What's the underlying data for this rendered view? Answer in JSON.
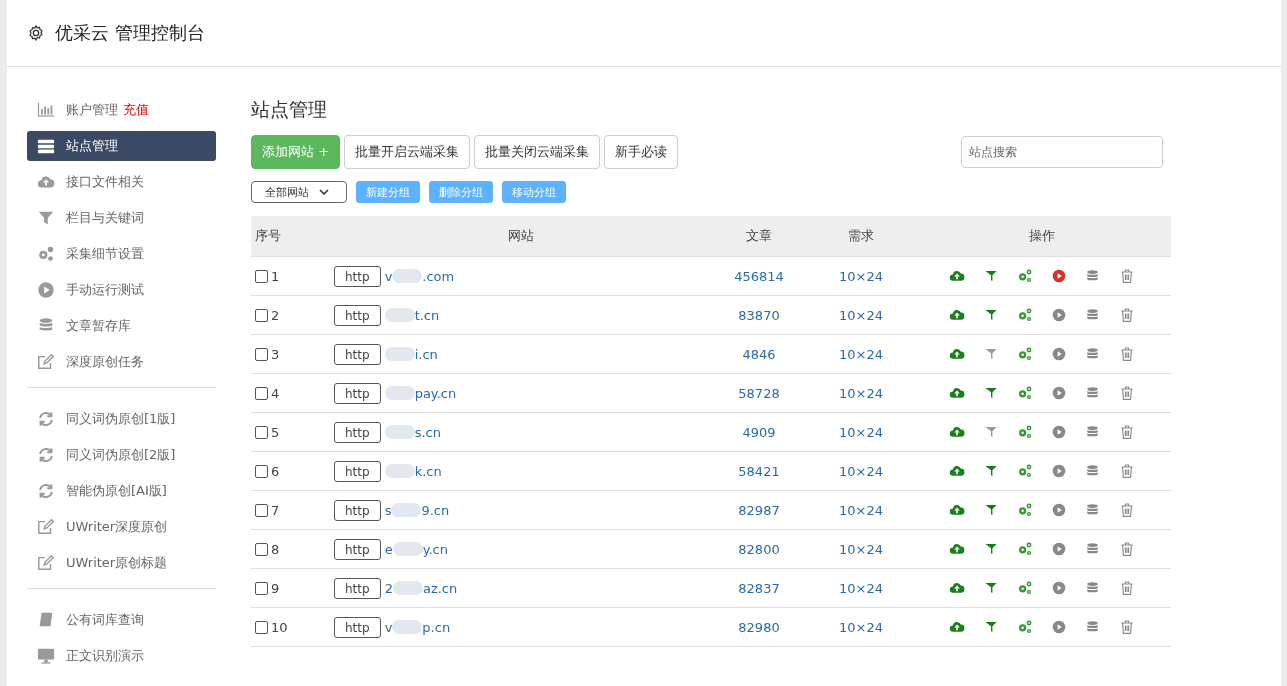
{
  "header": {
    "title": "优采云 管理控制台"
  },
  "sidebar": {
    "groups": [
      [
        {
          "label": "账户管理",
          "badge": "充值",
          "kind": "chart",
          "selected": false
        },
        {
          "label": "站点管理",
          "kind": "server",
          "selected": true
        },
        {
          "label": "接口文件相关",
          "kind": "cloud",
          "selected": false
        },
        {
          "label": "栏目与关键词",
          "kind": "filter",
          "selected": false
        },
        {
          "label": "采集细节设置",
          "kind": "gears",
          "selected": false
        },
        {
          "label": "手动运行测试",
          "kind": "play",
          "selected": false
        },
        {
          "label": "文章暂存库",
          "kind": "database",
          "selected": false
        },
        {
          "label": "深度原创任务",
          "kind": "edit",
          "selected": false
        }
      ],
      [
        {
          "label": "同义词伪原创[1版]",
          "kind": "refresh",
          "selected": false
        },
        {
          "label": "同义词伪原创[2版]",
          "kind": "refresh",
          "selected": false
        },
        {
          "label": "智能伪原创[AI版]",
          "kind": "refresh",
          "selected": false
        },
        {
          "label": "UWriter深度原创",
          "kind": "edit",
          "selected": false
        },
        {
          "label": "UWriter原创标题",
          "kind": "edit",
          "selected": false
        }
      ],
      [
        {
          "label": "公有词库查询",
          "kind": "book",
          "selected": false
        },
        {
          "label": "正文识别演示",
          "kind": "monitor",
          "selected": false
        }
      ]
    ]
  },
  "main": {
    "title": "站点管理",
    "add_button": "添加网站 +",
    "buttons": [
      "批量开启云端采集",
      "批量关闭云端采集",
      "新手必读"
    ],
    "search": {
      "placeholder": "站点搜索"
    },
    "group_select": "全部网站",
    "group_buttons": [
      "新建分组",
      "删除分组",
      "移动分组"
    ],
    "table": {
      "columns": [
        "序号",
        "网站",
        "文章",
        "需求",
        "操作"
      ],
      "rows": [
        {
          "no": "1",
          "checked": false,
          "protocol": "http",
          "site_start": "v",
          "site_end": ".com",
          "articles": "456814",
          "demand": "10×24",
          "filter_on": true,
          "running": true
        },
        {
          "no": "2",
          "checked": false,
          "protocol": "http",
          "site_end": "t.cn",
          "articles": "83870",
          "demand": "10×24",
          "filter_on": true,
          "running": false
        },
        {
          "no": "3",
          "checked": false,
          "protocol": "http",
          "site_end": "i.cn",
          "articles": "4846",
          "demand": "10×24",
          "filter_on": false,
          "running": false
        },
        {
          "no": "4",
          "checked": false,
          "protocol": "http",
          "site_end": "pay.cn",
          "articles": "58728",
          "demand": "10×24",
          "filter_on": true,
          "running": false
        },
        {
          "no": "5",
          "checked": false,
          "protocol": "http",
          "site_end": "s.cn",
          "articles": "4909",
          "demand": "10×24",
          "filter_on": false,
          "running": false
        },
        {
          "no": "6",
          "checked": false,
          "protocol": "http",
          "site_end": "k.cn",
          "articles": "58421",
          "demand": "10×24",
          "filter_on": true,
          "running": false
        },
        {
          "no": "7",
          "checked": false,
          "protocol": "http",
          "site_start": "s",
          "site_end": "9.cn",
          "articles": "82987",
          "demand": "10×24",
          "filter_on": true,
          "running": false
        },
        {
          "no": "8",
          "checked": false,
          "protocol": "http",
          "site_start": "e",
          "site_end": "y.cn",
          "articles": "82800",
          "demand": "10×24",
          "filter_on": true,
          "running": false
        },
        {
          "no": "9",
          "checked": false,
          "protocol": "http",
          "site_start": "2",
          "site_end": "az.cn",
          "articles": "82837",
          "demand": "10×24",
          "filter_on": true,
          "running": false
        },
        {
          "no": "10",
          "checked": false,
          "protocol": "http",
          "site_start": "v",
          "site_end": "p.cn",
          "articles": "82980",
          "demand": "10×24",
          "filter_on": true,
          "running": false
        }
      ]
    }
  }
}
